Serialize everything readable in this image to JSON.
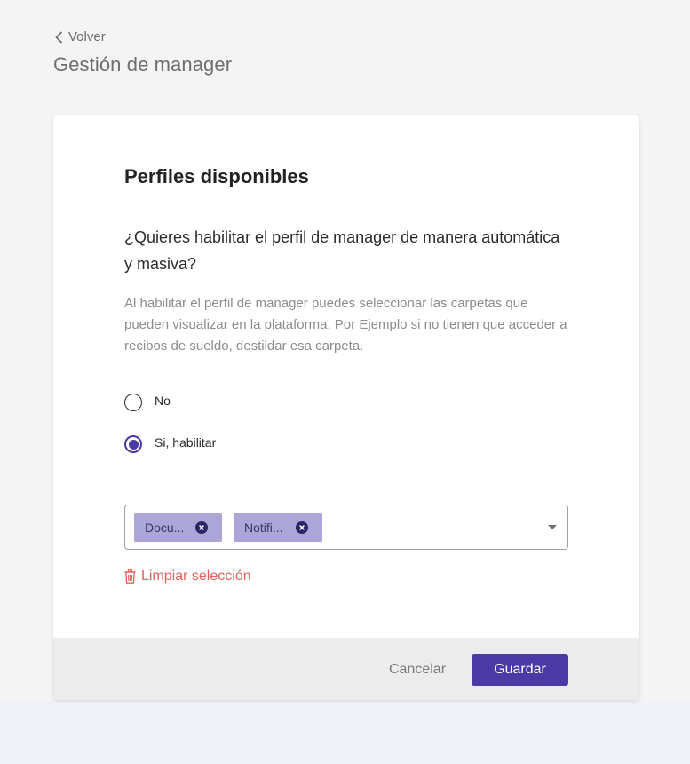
{
  "header": {
    "back_label": "Volver",
    "title": "Gestión de manager"
  },
  "card": {
    "section_title": "Perfiles disponibles",
    "question": "¿Quieres habilitar el perfil de manager de manera automática y masiva?",
    "description": "Al habilitar el perfil de manager puedes seleccionar las carpetas que pueden visualizar en la plataforma. Por Ejemplo si no tienen que acceder a recibos de sueldo, destildar esa carpeta.",
    "radio_options": [
      {
        "label": "No",
        "checked": false
      },
      {
        "label": "Si, habilitar",
        "checked": true
      }
    ],
    "multiselect": {
      "chips": [
        {
          "label": "Docu..."
        },
        {
          "label": "Notifi..."
        }
      ]
    },
    "clear_selection_label": "Limpiar selección"
  },
  "footer": {
    "cancel_label": "Cancelar",
    "save_label": "Guardar"
  },
  "colors": {
    "accent": "#4b3aa6",
    "chip_background": "#aca5d7",
    "danger": "#e0605a",
    "footer_background": "#ececec",
    "page_background": "#f4f4f5"
  },
  "icons": {
    "back": "chevron-left-icon",
    "chip_remove": "close-circle-icon",
    "dropdown": "caret-down-icon",
    "clear": "trash-icon"
  }
}
